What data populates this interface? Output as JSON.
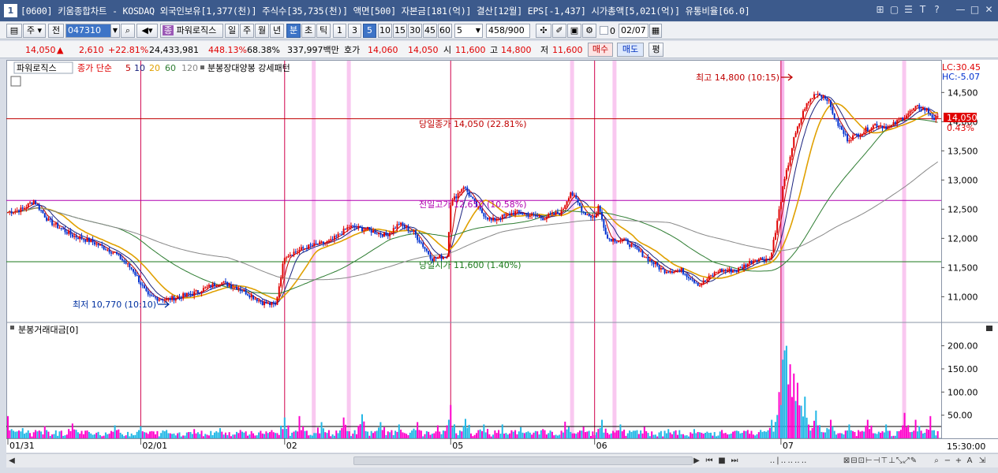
{
  "titlebar": {
    "num": "1",
    "title": "[0600] 키움종합차트 - KOSDAQ 외국인보유[1,377(천)] 주식수[35,735(천)] 액면[500] 자본금[181(억)] 결산[12월] EPS[-1,437] 시가총액[5,021(억)] 유통비율[66.0]",
    "ctrl_icons": [
      "⊞",
      "▢",
      "☰",
      "T",
      "?",
      "—",
      "□",
      "✕"
    ]
  },
  "toolbar": {
    "ju": "주",
    "jeon": "전",
    "code": "047310",
    "indicator": "파워로직스",
    "period_buttons": [
      "일",
      "주",
      "월",
      "년",
      "분",
      "초",
      "틱"
    ],
    "minutes": [
      "1",
      "3",
      "5",
      "10",
      "15",
      "30",
      "45",
      "60"
    ],
    "count": "5",
    "pages": "458",
    "pages_total": "/900",
    "checkbox_label": "0",
    "date": "02/07"
  },
  "quote": {
    "price": "14,050",
    "arrow": "▲",
    "change": "2,610",
    "pct": "+22.81%",
    "volume": "24,433,981",
    "ratio1": "448.13%",
    "ratio2": "68.38%",
    "amount": "337,997백만",
    "hoga_label": "호가",
    "hoga1": "14,060",
    "hoga2": "14,050",
    "open_label": "시",
    "open": "11,600",
    "high_label": "고",
    "high": "14,800",
    "low_label": "저",
    "low": "11,600",
    "buy": "매수",
    "sell": "매도",
    "avg": "평"
  },
  "chart_data": {
    "type": "candlestick",
    "legend": {
      "name": "파워로직스",
      "ma_title": "종가 단순",
      "ma_periods": [
        "5",
        "10",
        "20",
        "60",
        "120"
      ],
      "pattern": "분봉장대양봉 강세패턴"
    },
    "lc_label": "LC:30.45",
    "hc_label": "HC:-5.07",
    "price_axis": [
      "14,500",
      "14,000",
      "13,500",
      "13,000",
      "12,500",
      "12,000",
      "11,500",
      "11,000"
    ],
    "ylim": [
      10600,
      14950
    ],
    "current_price_tag": "14,050",
    "current_pct_tag": "0.43%",
    "annotations": {
      "high": "최고 14,800 (10:15)",
      "low": "최저 10,770 (10:10)",
      "today_close": "당일종가 14,050 (22.81%)",
      "prev_high": "전일고가 12,650 (10.58%)",
      "today_open": "당일시가 11,600 (1.40%)"
    },
    "hlines": {
      "today_close": 14050,
      "prev_high": 12650,
      "today_open": 11600
    },
    "x_labels": [
      "01/31",
      "02/01",
      "02",
      "05",
      "06",
      "07"
    ],
    "time_label": "15:30:00",
    "volume_title": "분봉거래대금[0]",
    "volume_axis": [
      "200.00",
      "150.00",
      "100.00",
      "50.00"
    ],
    "volume_ylim": [
      0,
      230
    ],
    "key_closes": [
      [
        0,
        12450
      ],
      [
        8,
        12500
      ],
      [
        14,
        12650
      ],
      [
        22,
        12300
      ],
      [
        35,
        12050
      ],
      [
        45,
        11950
      ],
      [
        58,
        11750
      ],
      [
        68,
        11450
      ],
      [
        76,
        11000
      ],
      [
        86,
        10950
      ],
      [
        100,
        11050
      ],
      [
        115,
        11250
      ],
      [
        125,
        11150
      ],
      [
        138,
        10900
      ],
      [
        145,
        10850
      ],
      [
        150,
        11700
      ],
      [
        162,
        11850
      ],
      [
        175,
        11950
      ],
      [
        185,
        12200
      ],
      [
        195,
        12150
      ],
      [
        205,
        12050
      ],
      [
        212,
        12250
      ],
      [
        220,
        12100
      ],
      [
        230,
        11650
      ],
      [
        238,
        11700
      ],
      [
        240,
        12600
      ],
      [
        247,
        12900
      ],
      [
        255,
        12500
      ],
      [
        262,
        12300
      ],
      [
        275,
        12450
      ],
      [
        290,
        12350
      ],
      [
        300,
        12450
      ],
      [
        305,
        12800
      ],
      [
        312,
        12450
      ],
      [
        318,
        12350
      ],
      [
        320,
        12550
      ],
      [
        325,
        12000
      ],
      [
        335,
        11950
      ],
      [
        345,
        11700
      ],
      [
        355,
        11450
      ],
      [
        365,
        11450
      ],
      [
        375,
        11200
      ],
      [
        385,
        11450
      ],
      [
        395,
        11450
      ],
      [
        405,
        11650
      ],
      [
        413,
        11650
      ],
      [
        416,
        12100
      ],
      [
        420,
        12850
      ],
      [
        426,
        13700
      ],
      [
        432,
        14250
      ],
      [
        438,
        14500
      ],
      [
        444,
        14400
      ],
      [
        449,
        14000
      ],
      [
        455,
        13700
      ],
      [
        462,
        13800
      ],
      [
        470,
        13950
      ],
      [
        478,
        13900
      ],
      [
        486,
        14100
      ],
      [
        493,
        14250
      ],
      [
        498,
        14200
      ],
      [
        502,
        14050
      ]
    ],
    "volume_spikes": [
      [
        0,
        48
      ],
      [
        8,
        22
      ],
      [
        20,
        26
      ],
      [
        35,
        32
      ],
      [
        48,
        12
      ],
      [
        58,
        28
      ],
      [
        72,
        26
      ],
      [
        86,
        18
      ],
      [
        101,
        20
      ],
      [
        115,
        22
      ],
      [
        126,
        18
      ],
      [
        140,
        15
      ],
      [
        150,
        45
      ],
      [
        158,
        48
      ],
      [
        170,
        35
      ],
      [
        182,
        45
      ],
      [
        192,
        52
      ],
      [
        202,
        35
      ],
      [
        212,
        30
      ],
      [
        222,
        35
      ],
      [
        233,
        28
      ],
      [
        240,
        72
      ],
      [
        248,
        42
      ],
      [
        258,
        30
      ],
      [
        268,
        30
      ],
      [
        278,
        24
      ],
      [
        290,
        20
      ],
      [
        302,
        36
      ],
      [
        312,
        25
      ],
      [
        322,
        40
      ],
      [
        332,
        30
      ],
      [
        345,
        25
      ],
      [
        358,
        20
      ],
      [
        372,
        20
      ],
      [
        387,
        18
      ],
      [
        401,
        18
      ],
      [
        414,
        40
      ],
      [
        418,
        100
      ],
      [
        420,
        170
      ],
      [
        421,
        190
      ],
      [
        422,
        200
      ],
      [
        424,
        160
      ],
      [
        426,
        140
      ],
      [
        428,
        120
      ],
      [
        432,
        90
      ],
      [
        438,
        60
      ],
      [
        446,
        40
      ],
      [
        456,
        30
      ],
      [
        466,
        40
      ],
      [
        476,
        30
      ],
      [
        486,
        55
      ],
      [
        492,
        40
      ],
      [
        500,
        48
      ]
    ],
    "vlines_red": [
      72,
      150,
      240,
      318
    ],
    "pink_bands": [
      166,
      185,
      306,
      329,
      486
    ],
    "pink_band_full": 420
  }
}
